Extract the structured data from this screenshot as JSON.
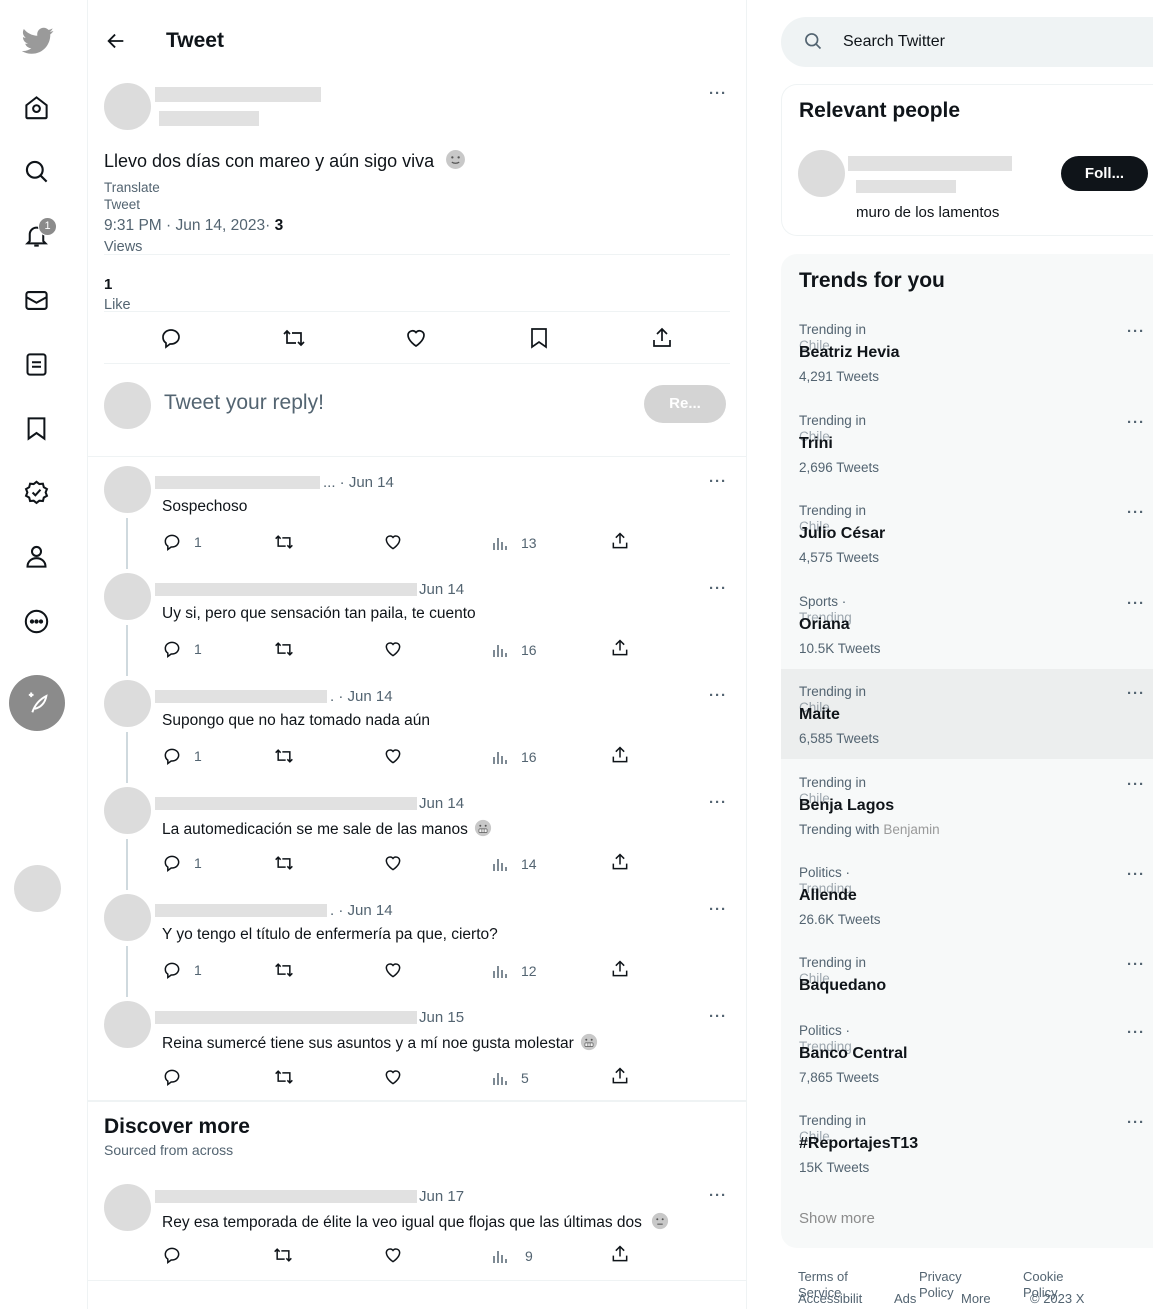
{
  "header": {
    "title": "Tweet"
  },
  "tweet": {
    "text": "Llevo dos días con mareo y aún sigo viva",
    "translate": "Translate",
    "tweet_label": "Tweet",
    "time": "9:31 PM · Jun 14, 2023·",
    "views_count": "3",
    "views_label": "Views",
    "likes_count": "1",
    "likes_label": "Like"
  },
  "composer": {
    "placeholder": "Tweet your reply!",
    "reply_button": "Re..."
  },
  "replies": [
    {
      "date": "... · Jun 14",
      "text": "Sospechoso",
      "replies": "1",
      "views": "13",
      "emoji": ""
    },
    {
      "date": "Jun 14",
      "text": "Uy si, pero que sensación tan paila, te cuento",
      "replies": "1",
      "views": "16",
      "emoji": ""
    },
    {
      "date": ". · Jun 14",
      "text": "Supongo que no haz tomado nada aún",
      "replies": "1",
      "views": "16",
      "emoji": ""
    },
    {
      "date": "Jun 14",
      "text": "La automedicación se me sale de las manos",
      "replies": "1",
      "views": "14",
      "emoji": "grimace"
    },
    {
      "date": ". · Jun 14",
      "text": "Y yo tengo el título de enfermería pa que, cierto?",
      "replies": "1",
      "views": "12",
      "emoji": ""
    },
    {
      "date": "Jun 15",
      "text": "Reina sumercé tiene sus asuntos y a mí noe gusta molestar",
      "replies": "",
      "views": "5",
      "emoji": "grimace"
    }
  ],
  "discover": {
    "title": "Discover more",
    "subtitle": "Sourced from across",
    "item": {
      "date": "Jun 17",
      "text": "Rey esa temporada de élite la veo igual que flojas que las últimas dos",
      "views": "9"
    }
  },
  "search": {
    "placeholder": "Search Twitter"
  },
  "relevant": {
    "title": "Relevant people",
    "bio": "muro de los lamentos",
    "follow": "Foll..."
  },
  "trends": {
    "title": "Trends for you",
    "items": [
      {
        "category": "Trending in",
        "overlap": "Chile",
        "name": "Beatriz Hevia",
        "count": "4,291 Tweets"
      },
      {
        "category": "Trending in",
        "overlap": "Chile",
        "name": "Trini",
        "count": "2,696 Tweets"
      },
      {
        "category": "Trending in",
        "overlap": "Chile",
        "name": "Julio César",
        "count": "4,575 Tweets"
      },
      {
        "category": "Sports ·",
        "overlap": "Trending",
        "name": "Oriana",
        "count": "10.5K Tweets"
      },
      {
        "category": "Trending in",
        "overlap": "Chile",
        "name": "Maite",
        "count": "6,585 Tweets"
      },
      {
        "category": "Trending in",
        "overlap": "Chile",
        "name": "Benja Lagos",
        "count": "Trending with",
        "with": "Benjamin"
      },
      {
        "category": "Politics ·",
        "overlap": "Trending",
        "name": "Allende",
        "count": "26.6K Tweets"
      },
      {
        "category": "Trending in",
        "overlap": "Chile",
        "name": "Baquedano",
        "count": ""
      },
      {
        "category": "Politics ·",
        "overlap": "Trending",
        "name": "Banco Central",
        "count": "7,865 Tweets"
      },
      {
        "category": "Trending in",
        "overlap": "Chile",
        "name": "#ReportajesT13",
        "count": "15K Tweets"
      }
    ],
    "show_more": "Show more"
  },
  "footer": {
    "terms": "Terms of",
    "terms2": "Service",
    "privacy": "Privacy",
    "privacy2": "Policy",
    "cookie": "Cookie",
    "cookie2": "Policy",
    "accessibility": "Accessibilit",
    "ads": "Ads",
    "more": "More",
    "copyright": "© 2023 X"
  },
  "nav": {
    "notification_badge": "1"
  },
  "colors": {
    "accent": "#8b8b8b",
    "text": "#0f1419",
    "muted": "#536471",
    "button_dark": "#0f1419"
  }
}
